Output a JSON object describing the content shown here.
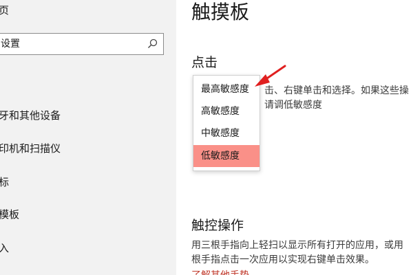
{
  "sidebar": {
    "home_label": "页",
    "search": {
      "placeholder": "设置"
    },
    "items": [
      {
        "label": "牙和其他设备"
      },
      {
        "label": "印机和扫描仪"
      },
      {
        "label": "标"
      },
      {
        "label": "模板"
      },
      {
        "label": "入"
      }
    ]
  },
  "main": {
    "title": "触摸板",
    "tap_section": {
      "heading": "点击",
      "desc_line1": "击、右键单击和选择。如果这些操",
      "desc_line2": "请调低敏感度"
    },
    "gesture_section": {
      "heading": "触控操作",
      "desc_line1": "用三根手指向上轻扫以显示所有打开的应用，或用",
      "desc_line2": "根手指点击一次应用以实现右键单击效果。",
      "link": "了解其他手势"
    }
  },
  "dropdown": {
    "options": [
      {
        "label": "最高敏感度"
      },
      {
        "label": "高敏感度"
      },
      {
        "label": "中敏感度"
      },
      {
        "label": "低敏感度"
      }
    ],
    "selected_index": 3
  },
  "colors": {
    "selected_option": "#fa9088",
    "annotation_arrow": "#e02020",
    "link": "#c0392b",
    "sidebar_bg": "#f2f2f2"
  },
  "icons": {
    "search": "search-icon",
    "annotation": "red-arrow-icon"
  }
}
